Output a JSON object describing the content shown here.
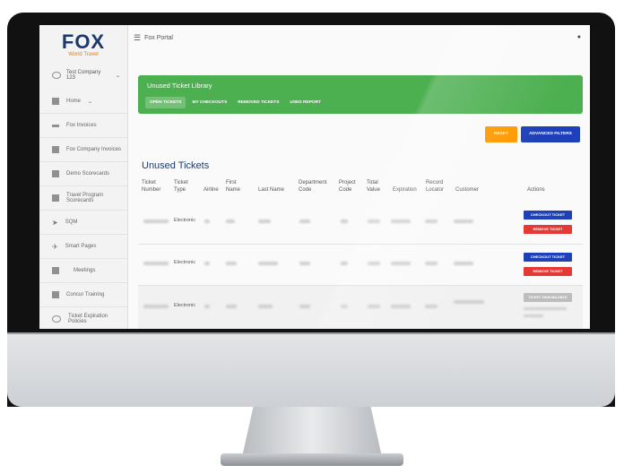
{
  "sidebar": {
    "logo": "FOX",
    "logo_sub": "World Travel",
    "company": "Test Company 123",
    "items": [
      {
        "label": "Home",
        "icon": "grid-icon"
      },
      {
        "label": "Fox Invoices",
        "icon": "list-icon"
      },
      {
        "label": "Fox Company Invoices",
        "icon": "window-icon"
      },
      {
        "label": "Demo Scorecards",
        "icon": "chart-icon"
      },
      {
        "label": "Travel Program Scorecards",
        "icon": "chart-icon"
      },
      {
        "label": "SQM",
        "icon": "send-icon"
      },
      {
        "label": "Smart Pages",
        "icon": "flight-icon"
      },
      {
        "label": "Meetings",
        "icon": "building-icon"
      },
      {
        "label": "Concur Training",
        "icon": "book-icon"
      },
      {
        "label": "Ticket Expiration Policies",
        "icon": "clock-icon"
      }
    ]
  },
  "topbar": {
    "title": "Fox Portal"
  },
  "library": {
    "title": "Unused Ticket Library",
    "tabs": [
      "OPEN TICKETS",
      "MY CHECKOUTS",
      "REMOVED TICKETS",
      "USED REPORT"
    ]
  },
  "buttons": {
    "reset": "RESET",
    "advanced": "ADVANCED FILTERS"
  },
  "section_title": "Unused Tickets",
  "table": {
    "headers": [
      "Ticket Number",
      "Ticket Type",
      "Airline",
      "First Name",
      "Last Name",
      "Department Code",
      "Project Code",
      "Total Value",
      "Expiration",
      "Record Locator",
      "Customer",
      "Actions"
    ],
    "rows": [
      {
        "type": "Electronic",
        "actions": [
          "CHECKOUT TICKET",
          "REMOVE TICKET"
        ]
      },
      {
        "type": "Electronic",
        "actions": [
          "CHECKOUT TICKET",
          "REMOVE TICKET"
        ]
      },
      {
        "type": "Electronic",
        "actions": [
          "TICKET UNAVAILABLE"
        ]
      }
    ]
  },
  "colors": {
    "header_green": "#4caf50",
    "primary_blue": "#1e40b8",
    "danger_red": "#e53935",
    "reset_orange": "#ff9800"
  }
}
